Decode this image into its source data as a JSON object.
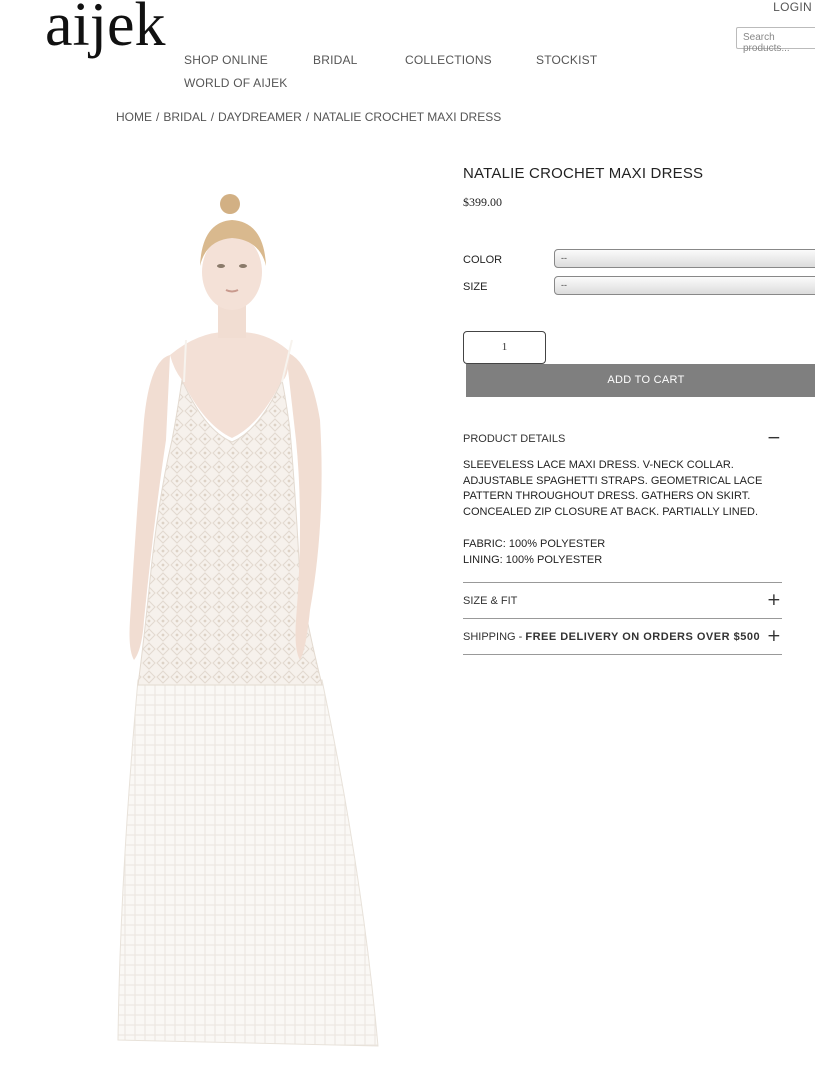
{
  "header": {
    "logo": "aijek",
    "login": "LOGIN",
    "search_placeholder": "Search products..."
  },
  "nav": {
    "items": [
      "SHOP ONLINE",
      "BRIDAL",
      "COLLECTIONS",
      "STOCKIST",
      "WORLD OF AIJEK"
    ]
  },
  "breadcrumb": [
    "HOME",
    "BRIDAL",
    "DAYDREAMER",
    "NATALIE CROCHET MAXI DRESS"
  ],
  "product": {
    "title": "NATALIE CROCHET MAXI DRESS",
    "price": "$399.00",
    "color_label": "COLOR",
    "color_value": "--",
    "size_label": "SIZE",
    "size_value": "--",
    "quantity": "1",
    "add_to_cart": "ADD TO CART"
  },
  "details": {
    "heading": "PRODUCT DETAILS",
    "toggle": "−",
    "description": "SLEEVELESS LACE MAXI DRESS. V-NECK COLLAR. ADJUSTABLE SPAGHETTI STRAPS. GEOMETRICAL LACE PATTERN THROUGHOUT DRESS. GATHERS ON SKIRT. CONCEALED ZIP CLOSURE AT BACK. PARTIALLY LINED.",
    "fabric": "FABRIC: 100% POLYESTER",
    "lining": "LINING: 100% POLYESTER"
  },
  "size_fit": {
    "heading": "SIZE & FIT",
    "toggle": "+"
  },
  "shipping": {
    "heading": "SHIPPING - ",
    "highlight": "FREE DELIVERY ON ORDERS OVER $500",
    "toggle": "+"
  }
}
